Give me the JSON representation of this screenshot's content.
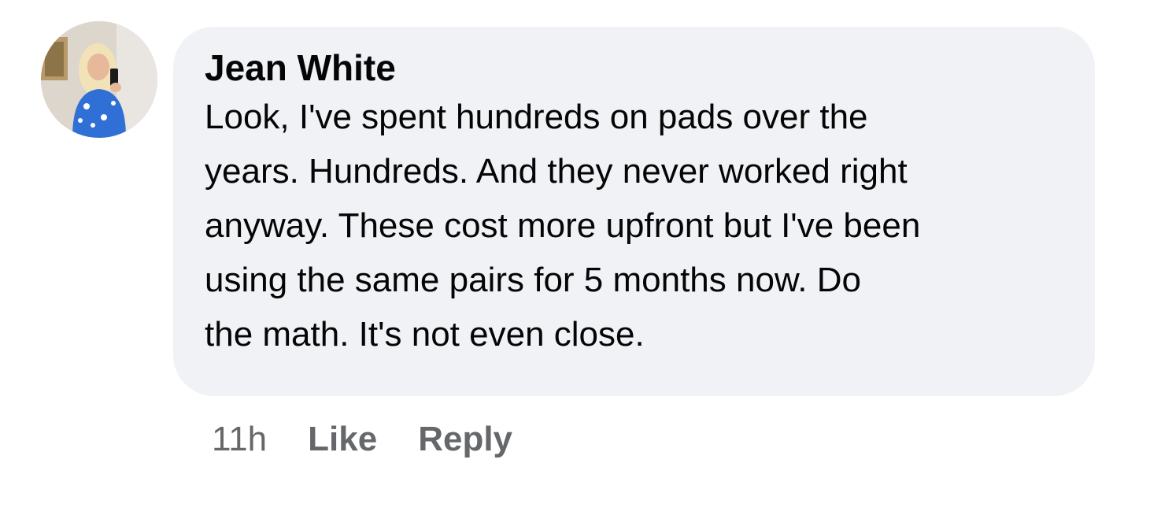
{
  "comment": {
    "author": "Jean White",
    "text": "Look, I've spent hundreds on pads over the\nyears. Hundreds. And they never worked right\nanyway. These cost more upfront but I've been\nusing the same pairs for 5 months now. Do\nthe math. It's not even close.",
    "timestamp": "11h",
    "like_label": "Like",
    "reply_label": "Reply"
  },
  "colors": {
    "bubble_background": "#f0f2f5",
    "primary_text": "#050505",
    "secondary_text": "#65676b"
  }
}
